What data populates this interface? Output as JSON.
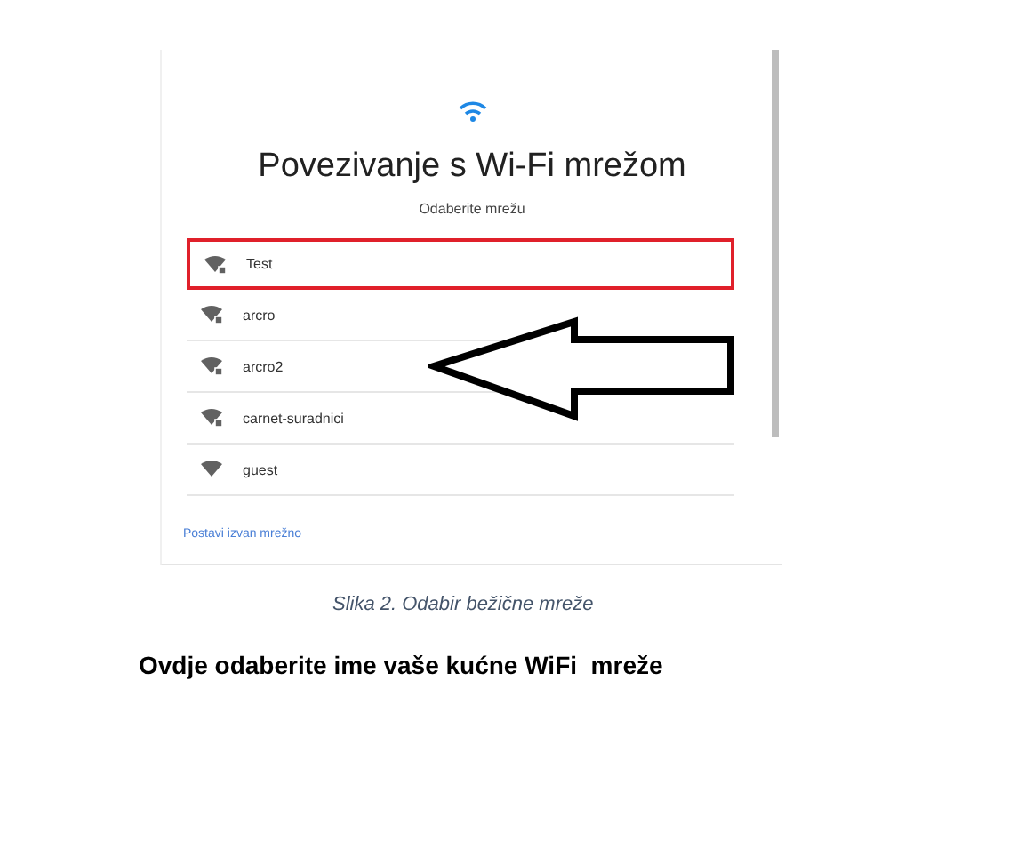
{
  "dialog": {
    "title": "Povezivanje s Wi-Fi mrežom",
    "subtitle": "Odaberite mrežu",
    "networks": [
      {
        "name": "Test",
        "locked": true,
        "highlighted": true
      },
      {
        "name": "arcro",
        "locked": true,
        "highlighted": false
      },
      {
        "name": "arcro2",
        "locked": true,
        "highlighted": false
      },
      {
        "name": "carnet-suradnici",
        "locked": true,
        "highlighted": false
      },
      {
        "name": "guest",
        "locked": false,
        "highlighted": false
      }
    ],
    "offline_link": "Postavi izvan mrežno"
  },
  "caption": "Slika 2. Odabir bežične mreže",
  "instruction": "Ovdje odaberite ime vaše kućne WiFi  mreže"
}
